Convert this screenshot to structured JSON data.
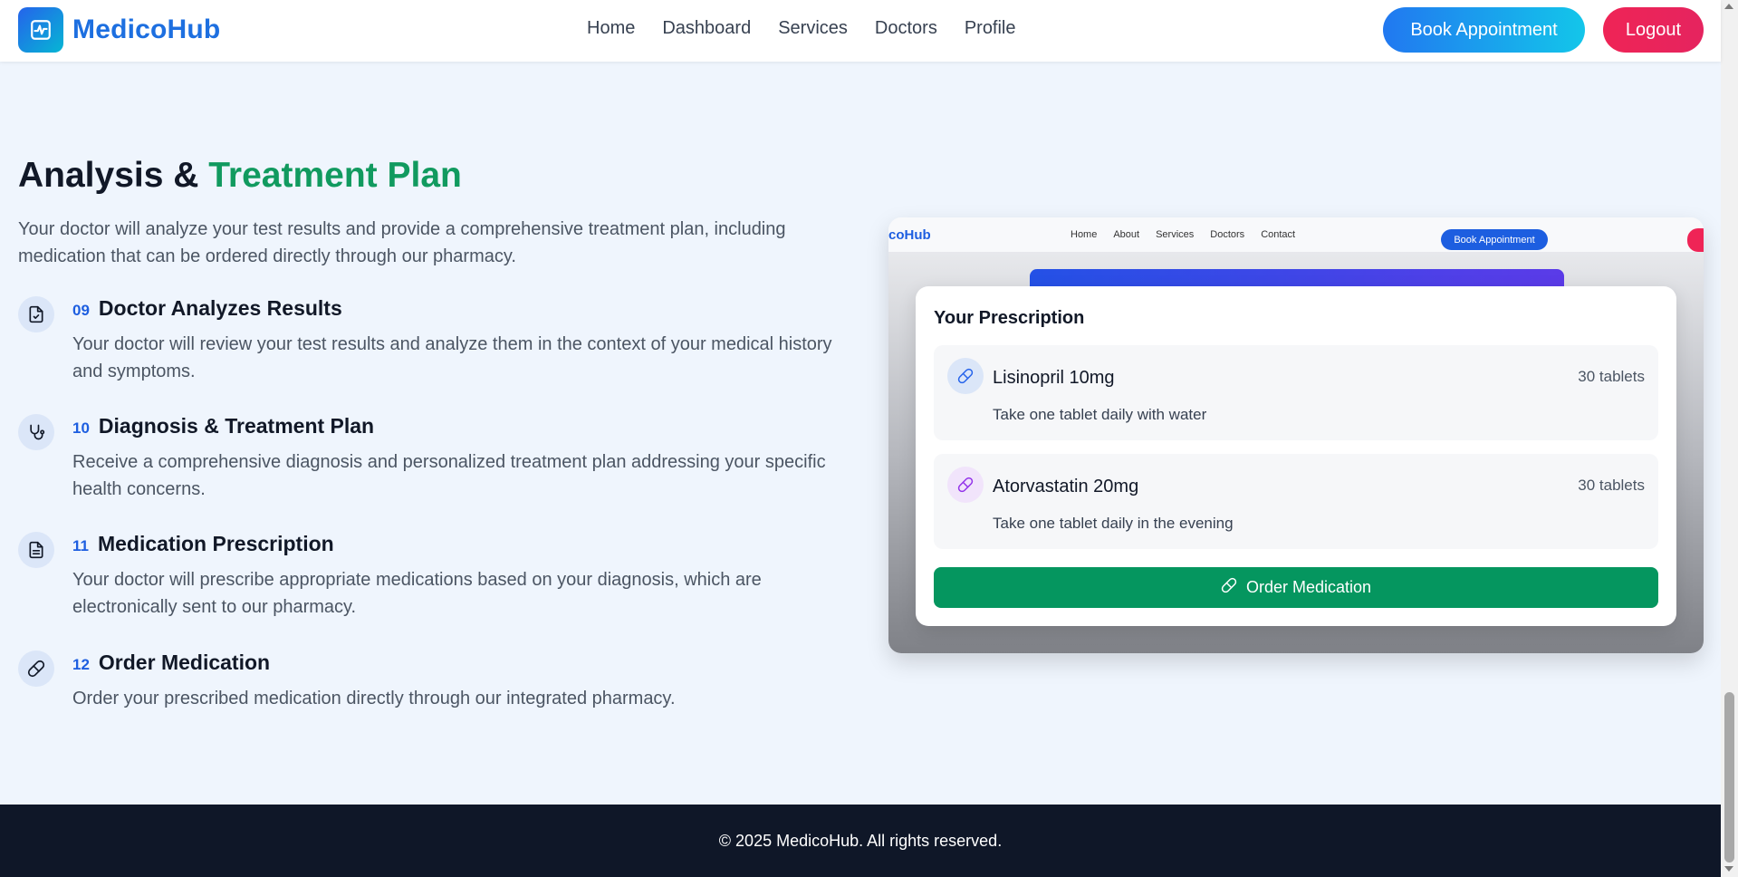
{
  "header": {
    "logo_text": "MedicoHub",
    "nav": [
      "Home",
      "Dashboard",
      "Services",
      "Doctors",
      "Profile"
    ],
    "book_label": "Book Appointment",
    "logout_label": "Logout"
  },
  "section": {
    "title_main": "Analysis & ",
    "title_accent": "Treatment Plan",
    "intro": "Your doctor will analyze your test results and provide a comprehensive treatment plan, including medication that can be ordered directly through our pharmacy.",
    "steps": [
      {
        "num": "09",
        "title": "Doctor Analyzes Results",
        "desc": "Your doctor will review your test results and analyze them in the context of your medical history and symptoms.",
        "icon": "file-check-icon"
      },
      {
        "num": "10",
        "title": "Diagnosis & Treatment Plan",
        "desc": "Receive a comprehensive diagnosis and personalized treatment plan addressing your specific health concerns.",
        "icon": "stethoscope-icon"
      },
      {
        "num": "11",
        "title": "Medication Prescription",
        "desc": "Your doctor will prescribe appropriate medications based on your diagnosis, which are electronically sent to our pharmacy.",
        "icon": "document-icon"
      },
      {
        "num": "12",
        "title": "Order Medication",
        "desc": "Order your prescribed medication directly through our integrated pharmacy.",
        "icon": "pill-icon"
      }
    ]
  },
  "mockup": {
    "logo": "coHub",
    "nav": [
      "Home",
      "About",
      "Services",
      "Doctors",
      "Contact"
    ],
    "book_label": "Book Appointment"
  },
  "prescription": {
    "title": "Your Prescription",
    "items": [
      {
        "name": "Lisinopril 10mg",
        "qty": "30 tablets",
        "instructions": "Take one tablet daily with water",
        "icon_color": "#2563eb",
        "icon_bg": "#dbe6f8"
      },
      {
        "name": "Atorvastatin 20mg",
        "qty": "30 tablets",
        "instructions": "Take one tablet daily in the evening",
        "icon_color": "#9333ea",
        "icon_bg": "#f1e4fb"
      }
    ],
    "order_label": "Order Medication"
  },
  "footer": {
    "text": "© 2025 MedicoHub. All rights reserved."
  }
}
